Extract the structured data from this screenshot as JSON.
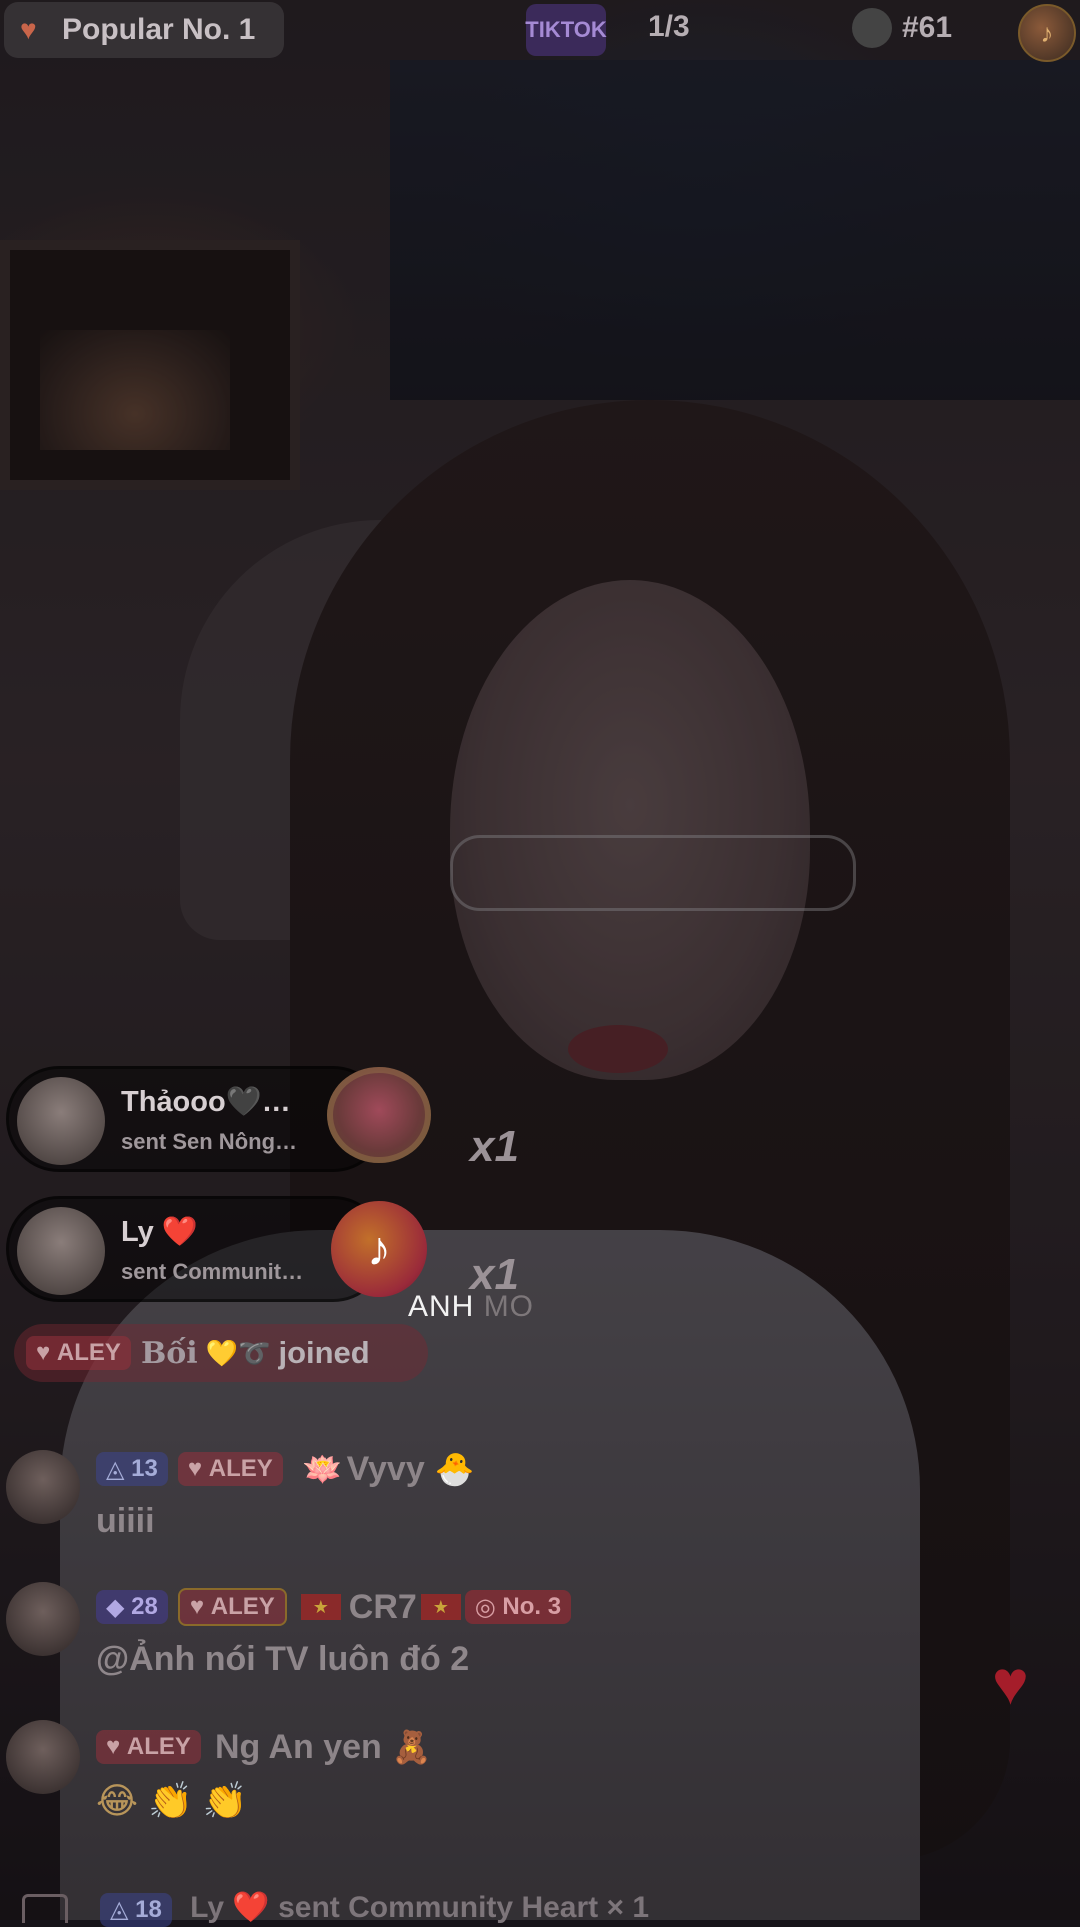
{
  "top_bar": {
    "popular_label": "Popular No. 1",
    "tiktok_badge": "TIKTOK",
    "page_counter": "1/3",
    "rank_label": "#61",
    "streamer_avatar_icon": "tiktok-icon"
  },
  "gift_toasts": [
    {
      "user": "Thảooo🖤…",
      "action": "sent Sen Nông…",
      "multiplier": "x1",
      "gift_icon": "lotus-heart-gift-icon"
    },
    {
      "user": "Ly ❤️",
      "action": "sent Communit…",
      "multiplier": "x1",
      "gift_icon": "tiktok-heart-gift-icon"
    }
  ],
  "caption": {
    "visible": "ANH ",
    "faded": "MO"
  },
  "join_banner": {
    "badge": "ALEY",
    "user": "Bối",
    "emoji": "💛➰",
    "verb": "joined"
  },
  "chat": [
    {
      "level": "13",
      "badge": "ALEY",
      "user": "Vyvy",
      "prefix_emoji": "🪷",
      "suffix_emoji": "🐣",
      "message": "uiiii"
    },
    {
      "level": "28",
      "badge": "ALEY",
      "user": "CR7",
      "rank_badge": "No. 3",
      "message": "@Ảnh nói TV luôn đó 2"
    },
    {
      "badge": "ALEY",
      "user": "Ng An yen",
      "suffix_emoji": "🧸",
      "message": "😂 👏 👏"
    }
  ],
  "bottom_notice": {
    "level": "18",
    "text": "Ly ❤️ sent Community Heart",
    "multiplier": "× 1"
  },
  "colors": {
    "accent_red": "#a51d2a",
    "aley_badge": "#963240",
    "level_badge": "#3c4696"
  }
}
